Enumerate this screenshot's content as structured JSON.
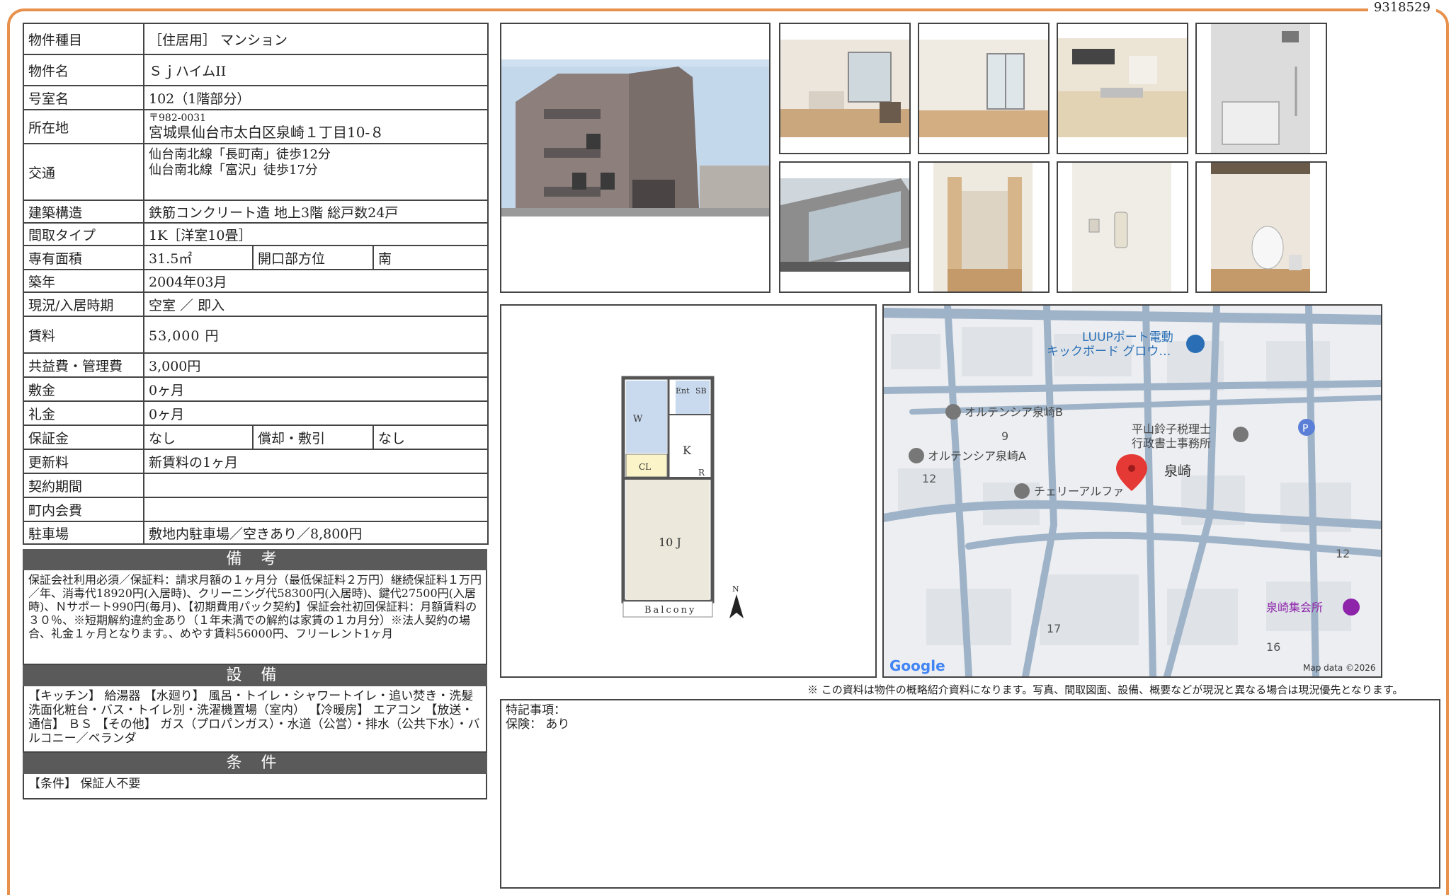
{
  "doc_id": "9318529",
  "spec": {
    "type_label": "物件種目",
    "type_value": "［住居用］ マンション",
    "name_label": "物件名",
    "name_value": "ＳｊハイムII",
    "room_label": "号室名",
    "room_value": "102（1階部分）",
    "location_label": "所在地",
    "zip": "〒982-0031",
    "address": "宮城県仙台市太白区泉崎１丁目10-８",
    "access_label": "交通",
    "access_1": "仙台南北線「長町南」徒歩12分",
    "access_2": "仙台南北線「富沢」徒歩17分",
    "structure_label": "建築構造",
    "structure_value": "鉄筋コンクリート造 地上3階 総戸数24戸",
    "layout_label": "間取タイプ",
    "layout_value": "1K［洋室10畳］",
    "area_label": "専有面積",
    "area_value": "31.5㎡",
    "direction_label": "開口部方位",
    "direction_value": "南",
    "built_label": "築年",
    "built_value": "2004年03月",
    "status_label": "現況/入居時期",
    "status_value": "空室 ／ 即入",
    "rent_label": "賃料",
    "rent_value": "53,000 円",
    "fee_label": "共益費・管理費",
    "fee_value": "3,000円",
    "deposit_label": "敷金",
    "deposit_value": "0ヶ月",
    "keymoney_label": "礼金",
    "keymoney_value": "0ヶ月",
    "guarantee_label": "保証金",
    "guarantee_value": "なし",
    "amort_label": "償却・敷引",
    "amort_value": "なし",
    "renewal_label": "更新料",
    "renewal_value": "新賃料の1ヶ月",
    "contract_label": "契約期間",
    "contract_value": "",
    "assoc_label": "町内会費",
    "assoc_value": "",
    "parking_label": "駐車場",
    "parking_value": "敷地内駐車場／空きあり／8,800円"
  },
  "remarks": {
    "title": "備 考",
    "text": "保証会社利用必須／保証料：請求月額の１ヶ月分（最低保証料２万円）継続保証料１万円／年、消毒代18920円(入居時)、クリーニング代58300円(入居時)、鍵代27500円(入居時)、Ｎサポート990円(毎月)、【初期費用パック契約】保証会社初回保証料：月額賃料の３０％、※短期解約違約金あり（１年未満での解約は家賃の１カ月分）※法人契約の場合、礼金１ヶ月となります。、めやす賃料56000円、フリーレント1ヶ月"
  },
  "equipment": {
    "title": "設 備",
    "text": "【キッチン】 給湯器 【水廻り】 風呂・トイレ・シャワートイレ・追い焚き・洗髪洗面化粧台・バス・トイレ別・洗濯機置場（室内） 【冷暖房】 エアコン 【放送・通信】 ＢＳ 【その他】 ガス（プロパンガス）・水道（公営）・排水（公共下水）・バルコニー／ベランダ"
  },
  "conditions": {
    "title": "条 件",
    "text": "【条件】 保証人不要"
  },
  "floorplan": {
    "ent": "Ent",
    "sb": "SB",
    "w": "W",
    "k": "K",
    "cl": "CL",
    "r": "R",
    "room": "10 J",
    "balcony": "Balcony",
    "north": "N"
  },
  "map": {
    "poi_luup": "LUUPポート電動",
    "poi_luup2": "キックボード グロウ…",
    "poi_ortB": "オルテンシア泉崎B",
    "poi_ortA": "オルテンシア泉崎A",
    "poi_hira1": "平山鈴子税理士",
    "poi_hira2": "行政書士事務所",
    "poi_cherry": "チェリーアルファ",
    "area": "泉崎",
    "hall": "泉崎集会所",
    "n9": "9",
    "n12a": "12",
    "n12b": "12",
    "n17": "17",
    "n16": "16",
    "google": "Google",
    "mapdata": "Map data ©2026",
    "parking_icon": "P"
  },
  "footnote": "※ この資料は物件の概略紹介資料になります。写真、間取図面、設備、概要などが現況と異なる場合は現況優先となります。",
  "special": {
    "title": "特記事項：",
    "insurance": "保険： あり"
  }
}
